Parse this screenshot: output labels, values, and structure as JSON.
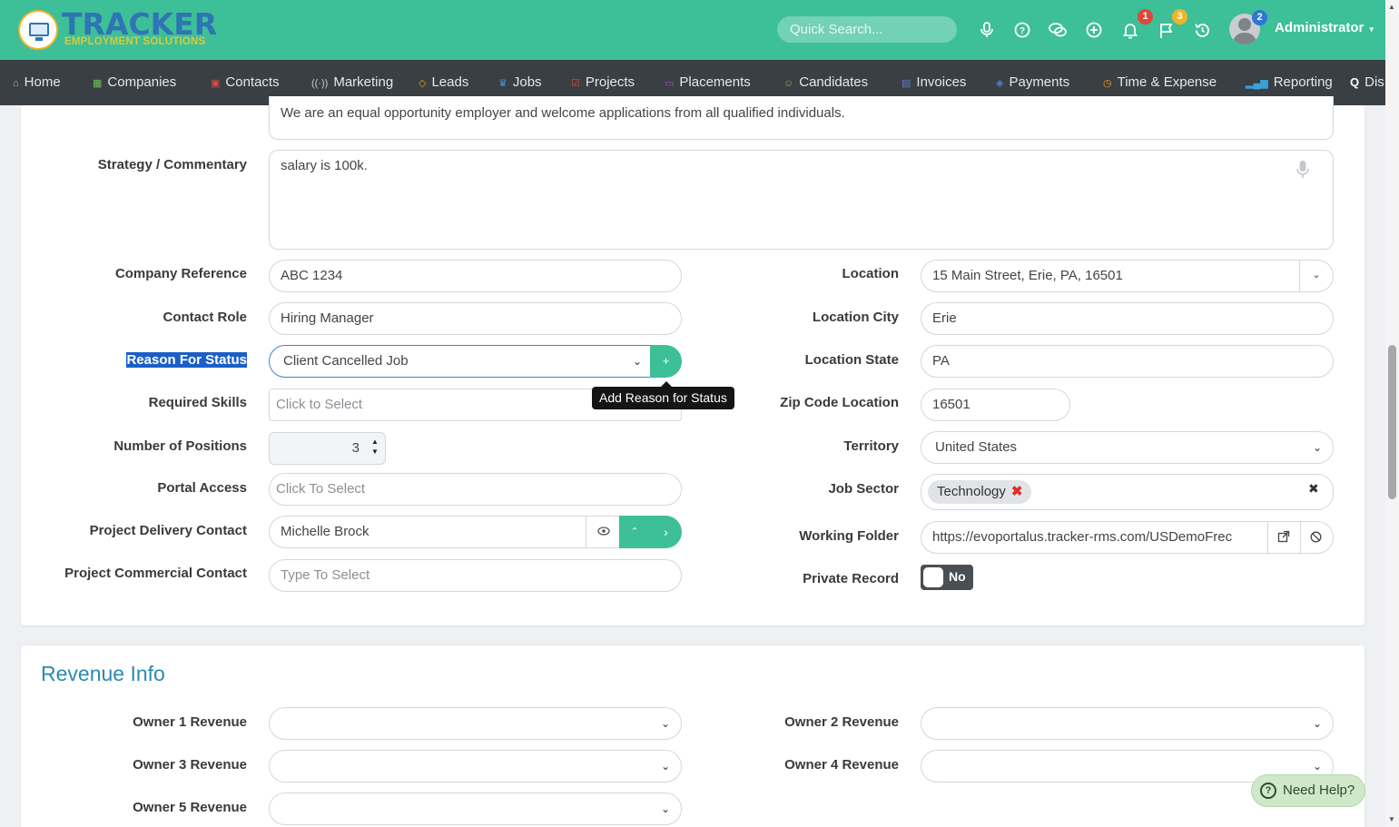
{
  "header": {
    "logo_text": "TRACKER",
    "logo_sub": "EMPLOYMENT SOLUTIONS",
    "search_placeholder": "Quick Search...",
    "notifications_count": "1",
    "flags_count": "3",
    "avatar_badge": "2",
    "user_name": "Administrator"
  },
  "nav": {
    "items": [
      {
        "label": "Home",
        "icon": "home-icon",
        "color": "#c9b37a"
      },
      {
        "label": "Companies",
        "icon": "building-icon",
        "color": "#6cc04a"
      },
      {
        "label": "Contacts",
        "icon": "contact-card-icon",
        "color": "#e0463c"
      },
      {
        "label": "Marketing",
        "icon": "broadcast-icon",
        "color": "#c9c9c9"
      },
      {
        "label": "Leads",
        "icon": "diamond-icon",
        "color": "#f0a21c"
      },
      {
        "label": "Jobs",
        "icon": "trophy-icon",
        "color": "#3aa1d6"
      },
      {
        "label": "Projects",
        "icon": "checklist-icon",
        "color": "#e0463c"
      },
      {
        "label": "Placements",
        "icon": "briefcase-icon",
        "color": "#9b59b6"
      },
      {
        "label": "Candidates",
        "icon": "person-icon",
        "color": "#6cc04a"
      },
      {
        "label": "Invoices",
        "icon": "document-icon",
        "color": "#5b7bd5"
      },
      {
        "label": "Payments",
        "icon": "payment-icon",
        "color": "#5b7bd5"
      },
      {
        "label": "Time & Expense",
        "icon": "clock-icon",
        "color": "#f0a21c"
      },
      {
        "label": "Reporting",
        "icon": "bar-chart-icon",
        "color": "#3aa1d6"
      },
      {
        "label": "Dis",
        "icon": "search-icon",
        "color": "#ffffff"
      }
    ]
  },
  "form": {
    "eeo_text": "We are an equal opportunity employer and welcome applications from all qualified individuals.",
    "strategy_label": "Strategy / Commentary",
    "strategy_value": "salary is 100k.",
    "company_reference_label": "Company Reference",
    "company_reference_value": "ABC 1234",
    "contact_role_label": "Contact Role",
    "contact_role_value": "Hiring Manager",
    "reason_label": "Reason For Status",
    "reason_value": "Client Cancelled Job",
    "reason_add_button": "+",
    "reason_tooltip": "Add Reason for Status",
    "required_skills_label": "Required Skills",
    "required_skills_placeholder": "Click to Select",
    "positions_label": "Number of Positions",
    "positions_value": "3",
    "portal_access_label": "Portal Access",
    "portal_access_placeholder": "Click To Select",
    "delivery_contact_label": "Project Delivery Contact",
    "delivery_contact_value": "Michelle Brock",
    "commercial_contact_label": "Project Commercial Contact",
    "commercial_contact_placeholder": "Type To Select",
    "location_label": "Location",
    "location_value": "15 Main Street, Erie, PA, 16501",
    "location_city_label": "Location City",
    "location_city_value": "Erie",
    "location_state_label": "Location State",
    "location_state_value": "PA",
    "zip_label": "Zip Code Location",
    "zip_value": "16501",
    "territory_label": "Territory",
    "territory_value": "United States",
    "job_sector_label": "Job Sector",
    "job_sector_tag": "Technology",
    "working_folder_label": "Working Folder",
    "working_folder_value": "https://evoportalus.tracker-rms.com/USDemoFrec",
    "private_record_label": "Private Record",
    "private_record_value": "No"
  },
  "revenue": {
    "title": "Revenue Info",
    "owner1_label": "Owner 1 Revenue",
    "owner2_label": "Owner 2 Revenue",
    "owner3_label": "Owner 3 Revenue",
    "owner4_label": "Owner 4 Revenue",
    "owner5_label": "Owner 5 Revenue"
  },
  "help": {
    "label": "Need Help?"
  },
  "colors": {
    "brand": "#3dbf97",
    "nav_bg": "#3a3f44",
    "section_title": "#2a8ab5",
    "highlight": "#1a5fc7"
  }
}
